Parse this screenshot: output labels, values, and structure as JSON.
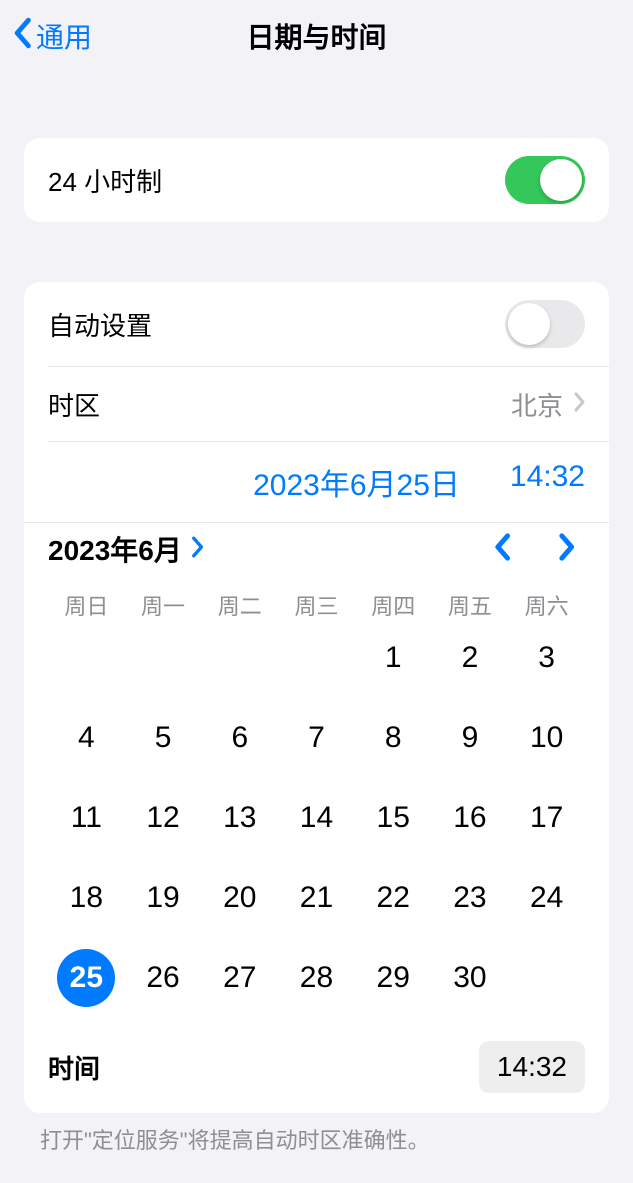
{
  "nav": {
    "back_label": "通用",
    "title": "日期与时间"
  },
  "group24h": {
    "label": "24 小时制",
    "on": true
  },
  "settings": {
    "auto_label": "自动设置",
    "auto_on": false,
    "tz_label": "时区",
    "tz_value": "北京",
    "date_value": "2023年6月25日",
    "time_value": "14:32"
  },
  "calendar": {
    "month_label": "2023年6月",
    "weekdays": [
      "周日",
      "周一",
      "周二",
      "周三",
      "周四",
      "周五",
      "周六"
    ],
    "leading_blanks": 4,
    "days_count": 30,
    "selected_day": 25,
    "time_label": "时间",
    "time_value": "14:32"
  },
  "footnote": "打开\"定位服务\"将提高自动时区准确性。"
}
